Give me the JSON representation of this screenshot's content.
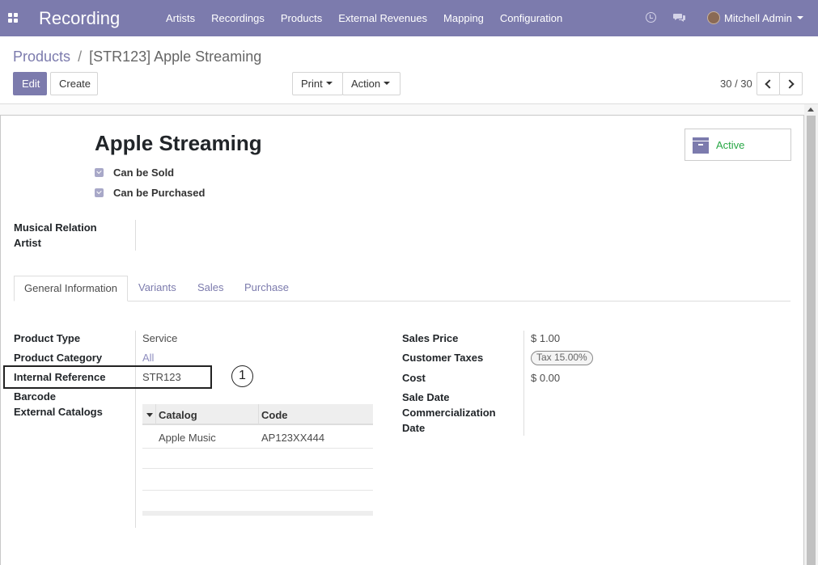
{
  "navbar": {
    "brand": "Recording",
    "menu": [
      "Artists",
      "Recordings",
      "Products",
      "External Revenues",
      "Mapping",
      "Configuration"
    ],
    "user": "Mitchell Admin",
    "bg_color": "#7c7bad"
  },
  "breadcrumb": {
    "parent": "Products",
    "separator": "/",
    "current": "[STR123] Apple Streaming"
  },
  "buttons": {
    "edit": "Edit",
    "create": "Create",
    "print": "Print",
    "action": "Action"
  },
  "pager": {
    "value": "30 / 30"
  },
  "record": {
    "name": "Apple Streaming",
    "can_be_sold": "Can be Sold",
    "can_be_purchased": "Can be Purchased",
    "active_label": "Active",
    "musical_relation_label": "Musical Relation",
    "artist_label": "Artist"
  },
  "tabs": [
    "General Information",
    "Variants",
    "Sales",
    "Purchase"
  ],
  "general": {
    "product_type_label": "Product Type",
    "product_type": "Service",
    "product_category_label": "Product Category",
    "product_category": "All",
    "internal_reference_label": "Internal Reference",
    "internal_reference": "STR123",
    "barcode_label": "Barcode",
    "external_catalogs_label": "External Catalogs",
    "sales_price_label": "Sales Price",
    "sales_price": "$ 1.00",
    "customer_taxes_label": "Customer Taxes",
    "customer_taxes": "Tax 15.00%",
    "cost_label": "Cost",
    "cost": "$ 0.00",
    "sale_date_label_1": "Sale Date",
    "sale_date_label_2": "Commercialization",
    "sale_date_label_3": "Date"
  },
  "catalogs_table": {
    "headers": [
      "Catalog",
      "Code"
    ],
    "rows": [
      {
        "catalog": "Apple Music",
        "code": "AP123XX444"
      }
    ]
  },
  "annotation": {
    "number": "1"
  }
}
